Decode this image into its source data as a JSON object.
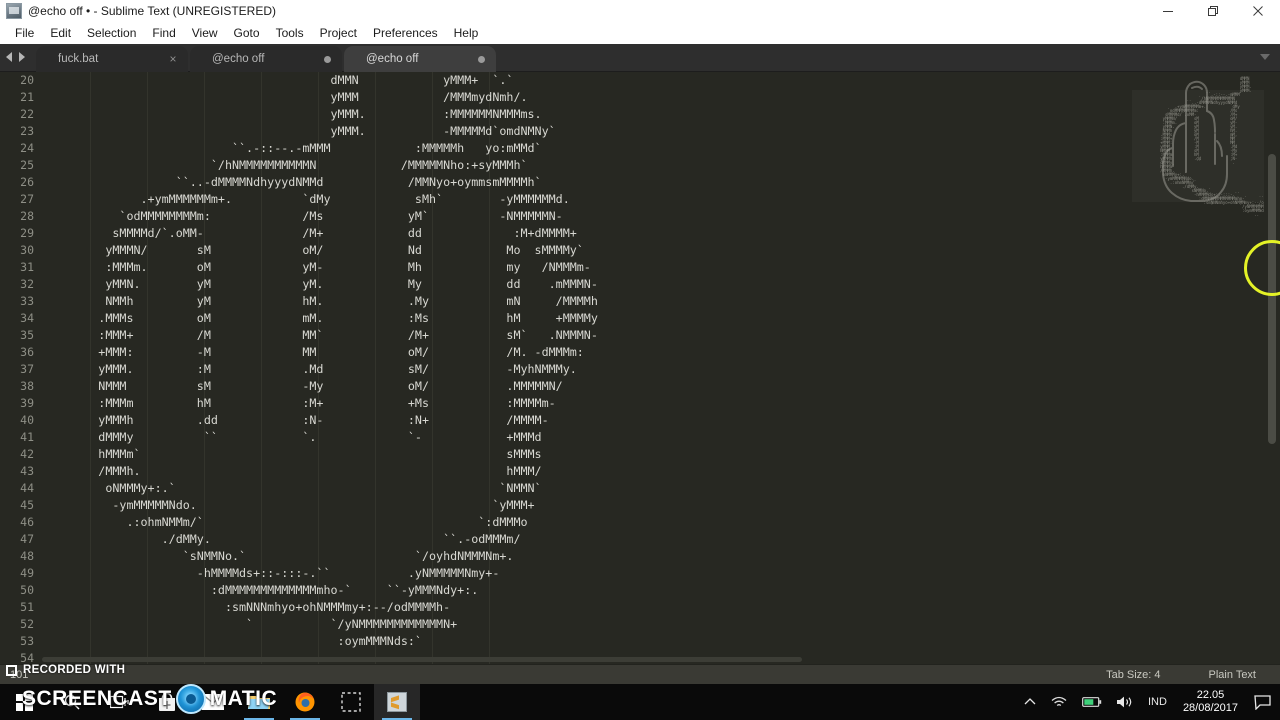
{
  "window": {
    "title": "@echo off • - Sublime Text (UNREGISTERED)",
    "app_icon": "sublime-text-icon",
    "controls": {
      "minimize": "minimize-icon",
      "maximize": "restore-icon",
      "close": "close-icon"
    }
  },
  "menubar": {
    "items": [
      {
        "label": "File"
      },
      {
        "label": "Edit"
      },
      {
        "label": "Selection"
      },
      {
        "label": "Find"
      },
      {
        "label": "View"
      },
      {
        "label": "Goto"
      },
      {
        "label": "Tools"
      },
      {
        "label": "Project"
      },
      {
        "label": "Preferences"
      },
      {
        "label": "Help"
      }
    ]
  },
  "tabbar": {
    "prev_icon": "chevron-left-icon",
    "next_icon": "chevron-right-icon",
    "overflow_icon": "chevron-down-icon",
    "tabs": [
      {
        "label": "fuck.bat",
        "state": "inactive",
        "indicator": "close",
        "close_glyph": "×"
      },
      {
        "label": "@echo off",
        "state": "inactive",
        "indicator": "dirty"
      },
      {
        "label": "@echo off",
        "state": "active",
        "indicator": "dirty"
      }
    ]
  },
  "editor": {
    "first_line_number": 20,
    "lines": [
      {
        "n": 20,
        "text": "                                         dMMN            yMMM+  `.`"
      },
      {
        "n": 21,
        "text": "                                         yMMM            /MMMmydNmh/."
      },
      {
        "n": 22,
        "text": "                                         yMMM.           :MMMMMMNMMMms."
      },
      {
        "n": 23,
        "text": "                                         yMMM.           -MMMMMd`omdNMNy`"
      },
      {
        "n": 24,
        "text": "                           ``.-::--.-mMMM            :MMMMMh   yo:mMMd`"
      },
      {
        "n": 25,
        "text": "                        `/hNMMMMMMMMMMN            /MMMMMNho:+syMMMh`"
      },
      {
        "n": 26,
        "text": "                   ``..-dMMMMNdhyyydNMMd            /MMNyo+oymmsmMMMMh`"
      },
      {
        "n": 27,
        "text": "              .+ymMMMMMMm+.          `dMy            sMh`        -yMMMMMMd."
      },
      {
        "n": 28,
        "text": "           `odMMMMMMMMm:             /Ms            yM`          -NMMMMMN-"
      },
      {
        "n": 29,
        "text": "          sMMMMd/`.oMM-              /M+            dd             :M+dMMMM+"
      },
      {
        "n": 30,
        "text": "         yMMMN/       sM             oM/            Nd            Mo  sMMMMy`"
      },
      {
        "n": 31,
        "text": "         :MMMm.       oM             yM-            Mh            my   /NMMMm-"
      },
      {
        "n": 32,
        "text": "         yMMN.        yM             yM.            My            dd    .mMMMN-"
      },
      {
        "n": 33,
        "text": "         NMMh         yM             hM.            .My           mN     /MMMMh"
      },
      {
        "n": 34,
        "text": "        .MMMs         oM             mM.            :Ms           hM     +MMMMy"
      },
      {
        "n": 35,
        "text": "        :MMM+         /M             MM`            /M+           sM`   .NMMMN-"
      },
      {
        "n": 36,
        "text": "        +MMM:         -M             MM             oM/           /M. -dMMMm:"
      },
      {
        "n": 37,
        "text": "        yMMM.         :M             .Md            sM/           -MyhNMMMy."
      },
      {
        "n": 38,
        "text": "        NMMM          sM             -My            oM/           .MMMMMN/"
      },
      {
        "n": 39,
        "text": "        :MMMm         hM             :M+            +Ms           :MMMMm-"
      },
      {
        "n": 40,
        "text": "        yMMMh         .dd            :N-            :N+           /MMMM-"
      },
      {
        "n": 41,
        "text": "        dMMMy          ``            `.             `-            +MMMd"
      },
      {
        "n": 42,
        "text": "        hMMMm`                                                    sMMMs"
      },
      {
        "n": 43,
        "text": "        /MMMh.                                                    hMMM/"
      },
      {
        "n": 44,
        "text": "         oNMMMy+:.`                                              `NMMN`"
      },
      {
        "n": 45,
        "text": "          -ymMMMMMNdo.                                          `yMMM+"
      },
      {
        "n": 46,
        "text": "            .:ohmNMMm/`                                       `:dMMMo"
      },
      {
        "n": 47,
        "text": "                 ./dMMy.                                 ``.-odMMMm/"
      },
      {
        "n": 48,
        "text": "                    `sNMMNo.`                        `/oyhdNMMMNm+."
      },
      {
        "n": 49,
        "text": "                      -hMMMMds+::-:::-.``           .yNMMMMMNmy+-"
      },
      {
        "n": 50,
        "text": "                        :dMMMMMMMMMMMMMmho-`     ``-yMMMNdy+:."
      },
      {
        "n": 51,
        "text": "                          :smNNNmhyo+ohNMMMmy+:--/odMMMMh-"
      },
      {
        "n": 52,
        "text": "                             `           `/yNMMMMMMMMMMMMN+"
      },
      {
        "n": 53,
        "text": "                                          :oymMMMNds:`"
      },
      {
        "n": 54,
        "text": "                                               .."
      }
    ]
  },
  "statusbar": {
    "line_col": "101",
    "tab_size": "Tab Size: 4",
    "syntax": "Plain Text"
  },
  "watermark": {
    "recorded_label": "RECORDED WITH",
    "brand_left": "SCREENCAST",
    "brand_right": "MATIC"
  },
  "taskbar": {
    "start_icon": "windows-start-icon",
    "search_icon": "search-icon",
    "taskview_icon": "task-view-icon",
    "apps": [
      {
        "name": "store-icon",
        "running": false
      },
      {
        "name": "mail-icon",
        "running": false
      },
      {
        "name": "file-explorer-icon",
        "running": true
      },
      {
        "name": "firefox-icon",
        "running": true
      },
      {
        "name": "snipping-tool-icon",
        "running": false
      },
      {
        "name": "sublime-text-icon",
        "running": true,
        "active": true
      }
    ],
    "tray": {
      "overflow_icon": "chevron-up-icon",
      "wifi_icon": "wifi-icon",
      "battery_icon": "battery-icon",
      "volume_icon": "volume-icon",
      "language": "IND",
      "time": "22.05",
      "date": "28/08/2017",
      "action_center_icon": "notification-icon"
    }
  },
  "colors": {
    "editor_background": "#272822",
    "editor_text": "#d8d8d2",
    "gutter_text": "#8e8f86",
    "statusbar_background": "#3a3a34",
    "cursor_ring": "#e4f227",
    "taskbar_background": "#0a0a0a"
  }
}
